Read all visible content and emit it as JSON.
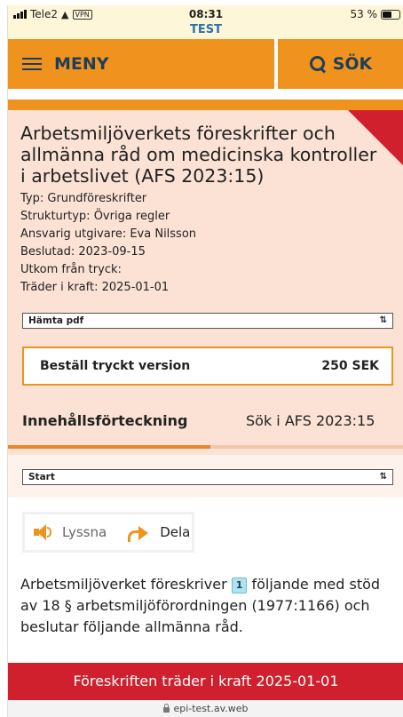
{
  "status_bar": {
    "carrier": "Tele2",
    "vpn": "VPN",
    "time": "08:31",
    "battery": "53 %",
    "battery_level": 0.53
  },
  "site_label": "TEST",
  "nav": {
    "menu_label": "MENY",
    "search_label": "SÖK"
  },
  "document": {
    "title": "Arbetsmiljöverkets föreskrifter och allmänna råd om medicinska kontroller i arbetslivet (AFS 2023:15)",
    "meta": [
      "Typ: Grundföreskrifter",
      "Strukturtyp: Övriga regler",
      "Ansvarig utgivare: Eva Nilsson",
      "Beslutad: 2023-09-15",
      "Utkom från tryck:",
      "Träder i kraft: 2025-01-01"
    ],
    "pdf_select": "Hämta pdf",
    "order_label": "Beställ tryckt version",
    "order_price": "250 SEK"
  },
  "tabs": {
    "toc": "Innehållsförteckning",
    "search": "Sök i AFS 2023:15"
  },
  "section_select": "Start",
  "actions": {
    "listen": "Lyssna",
    "share": "Dela"
  },
  "body": {
    "before": "Arbetsmiljöverket föreskriver ",
    "footnote": "1",
    "after": " följande med stöd av 18 § arbetsmiljöförordningen (1977:1166) och beslutar följande allmänna råd."
  },
  "banner": "Föreskriften träder i kraft 2025-01-01",
  "url": "epi-test.av.web",
  "colors": {
    "accent_orange": "#f0931e",
    "banner_red": "#d0202e",
    "panel_peach": "#fbe2d4",
    "nav_text": "#1f3e5a"
  }
}
